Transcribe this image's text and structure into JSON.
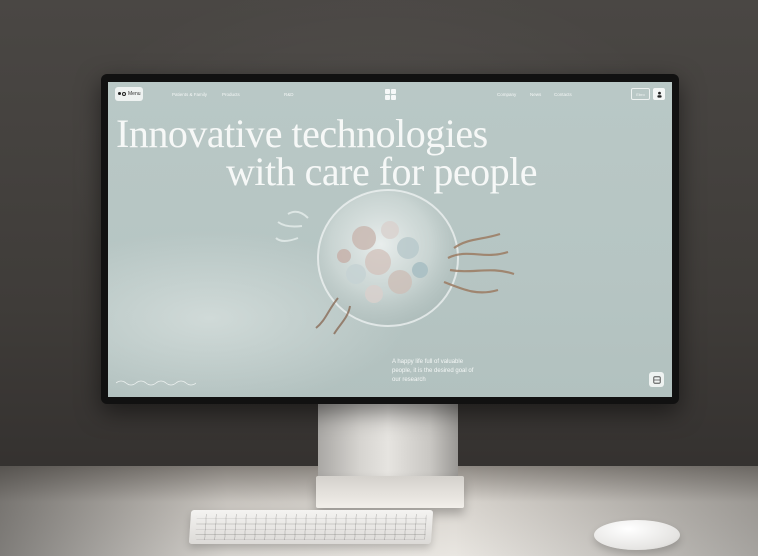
{
  "nav": {
    "menu_label": "Menu",
    "links_left": [
      "Patients & Family",
      "Products"
    ],
    "link_center": "R&D",
    "links_right": [
      "Company",
      "News",
      "Contacts"
    ],
    "button_label": "Ebro"
  },
  "hero": {
    "headline_line1": "Innovative technologies",
    "headline_line2": "with care for people",
    "tagline": "A happy life full of valuable people, it is the desired goal of our research"
  },
  "icons": {
    "menu": "menu-dots-icon",
    "logo": "brand-logo-icon",
    "account": "account-icon",
    "wave": "wave-line-icon",
    "corner": "grid-square-icon"
  },
  "colors": {
    "screen_bg": "#b6c5c3",
    "text_light": "#f6f8f7"
  }
}
